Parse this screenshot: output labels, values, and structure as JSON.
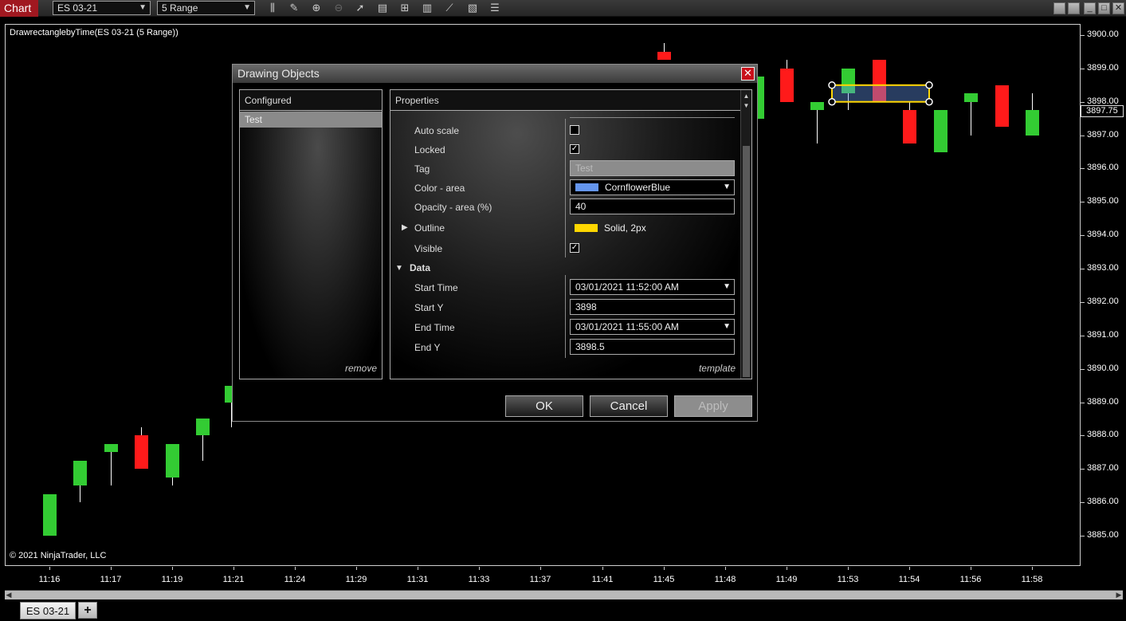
{
  "toolbar": {
    "chart_label": "Chart",
    "instrument": "ES 03-21",
    "interval": "5 Range"
  },
  "chart": {
    "title": "DrawrectanglebyTime(ES 03-21 (5 Range))",
    "copyright": "© 2021 NinjaTrader, LLC",
    "current_price": "3897.75",
    "y_labels": [
      "3900.00",
      "3899.00",
      "3898.00",
      "3897.00",
      "3896.00",
      "3895.00",
      "3894.00",
      "3893.00",
      "3892.00",
      "3891.00",
      "3890.00",
      "3889.00",
      "3888.00",
      "3887.00",
      "3886.00",
      "3885.00"
    ],
    "x_labels": [
      "11:16",
      "11:17",
      "11:19",
      "11:21",
      "11:24",
      "11:29",
      "11:31",
      "11:33",
      "11:37",
      "11:41",
      "11:45",
      "11:48",
      "11:49",
      "11:53",
      "11:54",
      "11:56",
      "11:58"
    ],
    "colors": {
      "up": "#33cc33",
      "down": "#ff1a1a",
      "rect_fill": "#6495ED",
      "rect_outline": "#FFD700"
    }
  },
  "chart_data": {
    "type": "candlestick",
    "title": "DrawrectanglebyTime(ES 03-21 (5 Range))",
    "ylim": [
      3884.5,
      3900.25
    ],
    "candles": [
      {
        "o": 3885.0,
        "c": 3886.25,
        "h": 3886.25,
        "l": 3885.0,
        "dir": "up"
      },
      {
        "o": 3886.5,
        "c": 3887.25,
        "h": 3887.25,
        "l": 3886.0,
        "dir": "up"
      },
      {
        "o": 3887.5,
        "c": 3887.75,
        "h": 3887.75,
        "l": 3886.5,
        "dir": "up"
      },
      {
        "o": 3888.0,
        "c": 3887.0,
        "h": 3888.25,
        "l": 3887.0,
        "dir": "down"
      },
      {
        "o": 3886.75,
        "c": 3887.75,
        "h": 3887.75,
        "l": 3886.5,
        "dir": "up"
      },
      {
        "o": 3888.0,
        "c": 3888.5,
        "h": 3888.5,
        "l": 3887.25,
        "dir": "up"
      },
      {
        "o": 3889.0,
        "c": 3889.5,
        "h": 3889.5,
        "l": 3888.25,
        "dir": "up"
      },
      {
        "o": 3899.25,
        "c": 3899.5,
        "h": 3899.75,
        "l": 3899.25,
        "dir": "down"
      },
      {
        "o": 3897.5,
        "c": 3898.75,
        "h": 3898.75,
        "l": 3897.5,
        "dir": "up"
      },
      {
        "o": 3899.0,
        "c": 3898.0,
        "h": 3899.25,
        "l": 3898.0,
        "dir": "down"
      },
      {
        "o": 3897.75,
        "c": 3898.0,
        "h": 3898.0,
        "l": 3896.75,
        "dir": "up"
      },
      {
        "o": 3898.25,
        "c": 3899.0,
        "h": 3899.0,
        "l": 3897.75,
        "dir": "up"
      },
      {
        "o": 3899.25,
        "c": 3898.0,
        "h": 3899.25,
        "l": 3898.0,
        "dir": "down"
      },
      {
        "o": 3897.75,
        "c": 3896.75,
        "h": 3898.0,
        "l": 3896.75,
        "dir": "down"
      },
      {
        "o": 3896.5,
        "c": 3897.75,
        "h": 3897.75,
        "l": 3896.5,
        "dir": "up"
      },
      {
        "o": 3898.0,
        "c": 3898.25,
        "h": 3898.25,
        "l": 3897.0,
        "dir": "up"
      },
      {
        "o": 3898.5,
        "c": 3897.25,
        "h": 3898.5,
        "l": 3897.25,
        "dir": "down"
      },
      {
        "o": 3897.0,
        "c": 3897.75,
        "h": 3898.25,
        "l": 3897.0,
        "dir": "up"
      }
    ],
    "rectangle": {
      "start_y": 3898,
      "end_y": 3898.5,
      "start_time": "11:52",
      "end_time": "11:55"
    }
  },
  "dialog": {
    "title": "Drawing Objects",
    "configured_header": "Configured",
    "configured_items": [
      "Test"
    ],
    "remove_label": "remove",
    "properties_header": "Properties",
    "template_label": "template",
    "props": {
      "auto_scale_label": "Auto scale",
      "locked_label": "Locked",
      "tag_label": "Tag",
      "tag_value": "Test",
      "color_area_label": "Color - area",
      "color_area_value": "CornflowerBlue",
      "opacity_label": "Opacity - area (%)",
      "opacity_value": "40",
      "outline_label": "Outline",
      "outline_value": "Solid, 2px",
      "visible_label": "Visible",
      "data_section_label": "Data",
      "start_time_label": "Start Time",
      "start_time_value": "03/01/2021 11:52:00 AM",
      "start_y_label": "Start Y",
      "start_y_value": "3898",
      "end_time_label": "End Time",
      "end_time_value": "03/01/2021 11:55:00 AM",
      "end_y_label": "End Y",
      "end_y_value": "3898.5"
    },
    "ok_label": "OK",
    "cancel_label": "Cancel",
    "apply_label": "Apply"
  },
  "tabs": {
    "active": "ES 03-21",
    "add": "+"
  }
}
